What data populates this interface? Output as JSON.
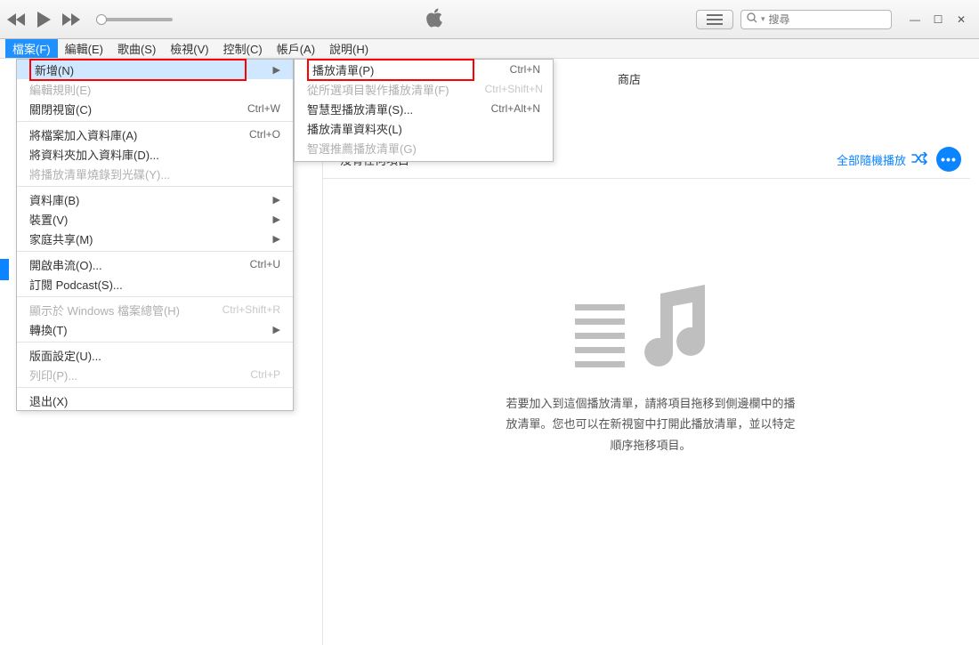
{
  "toolbar": {
    "search_placeholder": "搜尋"
  },
  "menubar": [
    {
      "label": "檔案(F)",
      "active": true
    },
    {
      "label": "編輯(E)"
    },
    {
      "label": "歌曲(S)"
    },
    {
      "label": "檢視(V)"
    },
    {
      "label": "控制(C)"
    },
    {
      "label": "帳戶(A)"
    },
    {
      "label": "說明(H)"
    }
  ],
  "file_menu": [
    {
      "label": "新增(N)",
      "type": "submenu",
      "highlight": true,
      "redbox": true
    },
    {
      "label": "編輯規則(E)",
      "disabled": true
    },
    {
      "label": "關閉視窗(C)",
      "accel": "Ctrl+W"
    },
    {
      "type": "sep"
    },
    {
      "label": "將檔案加入資料庫(A)",
      "accel": "Ctrl+O"
    },
    {
      "label": "將資料夾加入資料庫(D)..."
    },
    {
      "label": "將播放清單燒錄到光碟(Y)...",
      "disabled": true
    },
    {
      "type": "sep"
    },
    {
      "label": "資料庫(B)",
      "type": "submenu"
    },
    {
      "label": "裝置(V)",
      "type": "submenu"
    },
    {
      "label": "家庭共享(M)",
      "type": "submenu"
    },
    {
      "type": "sep"
    },
    {
      "label": "開啟串流(O)...",
      "accel": "Ctrl+U"
    },
    {
      "label": "訂閱 Podcast(S)..."
    },
    {
      "type": "sep"
    },
    {
      "label": "顯示於 Windows 檔案總管(H)",
      "accel": "Ctrl+Shift+R",
      "disabled": true
    },
    {
      "label": "轉換(T)",
      "type": "submenu"
    },
    {
      "type": "sep"
    },
    {
      "label": "版面設定(U)..."
    },
    {
      "label": "列印(P)...",
      "accel": "Ctrl+P",
      "disabled": true
    },
    {
      "type": "sep"
    },
    {
      "label": "退出(X)"
    }
  ],
  "new_submenu": [
    {
      "label": "播放清單(P)",
      "accel": "Ctrl+N",
      "redbox": true
    },
    {
      "label": "從所選項目製作播放清單(F)",
      "accel": "Ctrl+Shift+N",
      "disabled": true
    },
    {
      "label": "智慧型播放清單(S)...",
      "accel": "Ctrl+Alt+N"
    },
    {
      "label": "播放清單資料夾(L)"
    },
    {
      "label": "智選推薦播放清單(G)",
      "disabled": true
    }
  ],
  "header": {
    "store": "商店",
    "no_items": "沒有任何項目",
    "shuffle_all": "全部隨機播放"
  },
  "empty": {
    "line1": "若要加入到這個播放清單，請將項目拖移到側邊欄中的播",
    "line2": "放清單。您也可以在新視窗中打開此播放清單，並以特定",
    "line3": "順序拖移項目。"
  }
}
